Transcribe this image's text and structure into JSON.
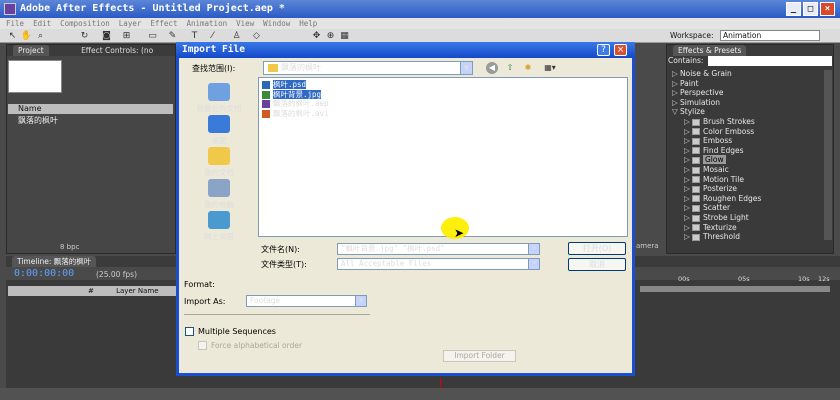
{
  "app": {
    "title": "Adobe After Effects - Untitled Project.aep *",
    "menu": [
      "File",
      "Edit",
      "Composition",
      "Layer",
      "Effect",
      "Animation",
      "View",
      "Window",
      "Help"
    ],
    "workspace_label": "Workspace:",
    "workspace_value": "Animation"
  },
  "project": {
    "tab_project": "Project",
    "tab_effect_controls": "Effect Controls: (no",
    "list_name_header": "Name",
    "item": "飘落的枫叶",
    "bpc": "8 bpc"
  },
  "timeline": {
    "tab": "Timeline: 飘落的枫叶",
    "timecode": "0:00:00:00",
    "fps": "(25.00 fps)",
    "layer_name_header": "Layer Name",
    "hash": "#",
    "ticks": [
      "00s",
      "05s",
      "10s",
      "12s"
    ],
    "camera": "amera"
  },
  "effects": {
    "tab": "Effects & Presets",
    "contains": "Contains:",
    "items": [
      {
        "label": "Noise & Grain",
        "kind": "category",
        "open": false
      },
      {
        "label": "Paint",
        "kind": "category",
        "open": false
      },
      {
        "label": "Perspective",
        "kind": "category",
        "open": false
      },
      {
        "label": "Simulation",
        "kind": "category",
        "open": false
      },
      {
        "label": "Stylize",
        "kind": "category",
        "open": true
      },
      {
        "label": "Brush Strokes",
        "kind": "effect"
      },
      {
        "label": "Color Emboss",
        "kind": "effect"
      },
      {
        "label": "Emboss",
        "kind": "effect"
      },
      {
        "label": "Find Edges",
        "kind": "effect"
      },
      {
        "label": "Glow",
        "kind": "effect",
        "selected": true
      },
      {
        "label": "Mosaic",
        "kind": "effect"
      },
      {
        "label": "Motion Tile",
        "kind": "effect"
      },
      {
        "label": "Posterize",
        "kind": "effect"
      },
      {
        "label": "Roughen Edges",
        "kind": "effect"
      },
      {
        "label": "Scatter",
        "kind": "effect"
      },
      {
        "label": "Strobe Light",
        "kind": "effect"
      },
      {
        "label": "Texturize",
        "kind": "effect"
      },
      {
        "label": "Threshold",
        "kind": "effect"
      }
    ]
  },
  "dialog": {
    "title": "Import File",
    "help": "?",
    "close": "×",
    "look_in_label": "查找范围(I):",
    "look_in_value": "飘落的枫叶",
    "places": [
      "我最近的文档",
      "桌面",
      "我的文档",
      "我的电脑",
      "网上邻居"
    ],
    "files": [
      {
        "name": "枫叶.psd",
        "selected": true,
        "icon_color": "#2a6ab0"
      },
      {
        "name": "枫叶背景.jpg",
        "selected": true,
        "icon_color": "#3a8a3a"
      },
      {
        "name": "飘落的枫叶.aep",
        "selected": false,
        "icon_color": "#6a3fa0"
      },
      {
        "name": "飘落的枫叶.avi",
        "selected": false,
        "icon_color": "#d05a20"
      }
    ],
    "file_name_label": "文件名(N):",
    "file_name_value": "\"枫叶背景.jpg\" \"枫叶.psd\"",
    "file_type_label": "文件类型(T):",
    "file_type_value": "All Acceptable Files",
    "open_button": "打开(O)",
    "cancel_button": "取消",
    "format_label": "Format:",
    "import_as_label": "Import As:",
    "import_as_value": "Footage",
    "multiple_sequences": "Multiple Sequences",
    "force_alpha": "Force alphabetical order",
    "import_folder": "Import Folder"
  }
}
